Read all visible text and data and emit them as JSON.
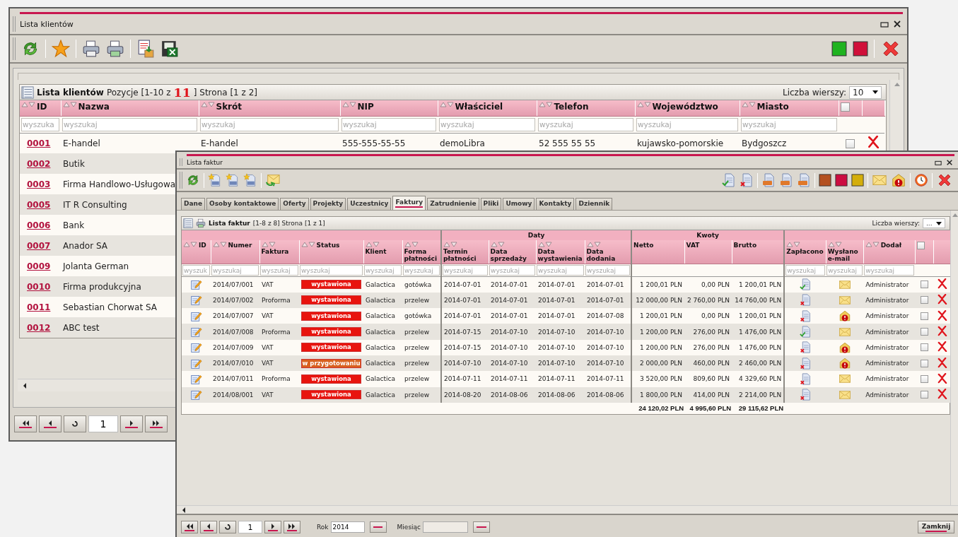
{
  "clients_window": {
    "title": "Lista klientów",
    "list_title": "Lista klientów",
    "positions_label": "Pozycje [1-10 z",
    "positions_count": "11",
    "page_label": "] Strona [1 z 2]",
    "rows_label": "Liczba wierszy:",
    "rows_value": "10",
    "columns": [
      {
        "kind": "text",
        "label": "ID",
        "placeholder": "wyszuka"
      },
      {
        "kind": "text",
        "label": "Nazwa",
        "placeholder": "wyszukaj"
      },
      {
        "kind": "text",
        "label": "Skrót",
        "placeholder": "wyszukaj"
      },
      {
        "kind": "text",
        "label": "NIP",
        "placeholder": "wyszukaj"
      },
      {
        "kind": "text",
        "label": "Właściciel",
        "placeholder": "wyszukaj"
      },
      {
        "kind": "text",
        "label": "Telefon",
        "placeholder": "wyszukaj"
      },
      {
        "kind": "text",
        "label": "Województwo",
        "placeholder": "wyszukaj"
      },
      {
        "kind": "text",
        "label": "Miasto",
        "placeholder": "wyszukaj"
      },
      {
        "kind": "checkbox",
        "checked": false
      },
      {
        "kind": "blank"
      }
    ],
    "rows": [
      {
        "id": "0001",
        "name": "E-handel",
        "short": "E-handel",
        "nip": "555-555-55-55",
        "owner": "demoLibra",
        "phone": "52 555 55 55",
        "region": "kujawsko-pomorskie",
        "city": "Bydgoszcz",
        "checked": false
      },
      {
        "id": "0002",
        "name": "Butik"
      },
      {
        "id": "0003",
        "name": "Firma Handlowo-Usługowa"
      },
      {
        "id": "0005",
        "name": "IT R Consulting"
      },
      {
        "id": "0006",
        "name": "Bank"
      },
      {
        "id": "0007",
        "name": "Anador SA"
      },
      {
        "id": "0009",
        "name": "Jolanta German"
      },
      {
        "id": "0010",
        "name": "Firma produkcyjna"
      },
      {
        "id": "0011",
        "name": "Sebastian Chorwat SA"
      },
      {
        "id": "0012",
        "name": "ABC test"
      }
    ],
    "page": "1"
  },
  "invoices_window": {
    "title": "Lista faktur",
    "tabs": [
      {
        "label": "Dane",
        "selected": false
      },
      {
        "label": "Osoby kontaktowe",
        "selected": false
      },
      {
        "label": "Oferty",
        "selected": false
      },
      {
        "label": "Projekty",
        "selected": false
      },
      {
        "label": "Uczestnicy",
        "selected": false
      },
      {
        "label": "Faktury",
        "selected": true
      },
      {
        "label": "Zatrudnienie",
        "selected": false
      },
      {
        "label": "Pliki",
        "selected": false
      },
      {
        "label": "Umowy",
        "selected": false
      },
      {
        "label": "Kontakty",
        "selected": false
      },
      {
        "label": "Dziennik",
        "selected": false
      }
    ],
    "list_title": "Lista faktur",
    "list_info": "[1-8 z 8] Strona [1 z 1]",
    "rows_label": "Liczba wierszy:",
    "rows_value": "...",
    "column_groups": [
      {
        "columns": [
          {
            "kind": "text",
            "label": "ID",
            "sortable": true,
            "placeholder": "wyszuk"
          },
          {
            "kind": "text",
            "label": "Numer",
            "sortable": true,
            "placeholder": "wyszukaj"
          },
          {
            "kind": "text",
            "label": "Faktura",
            "sortable": true,
            "placeholder": "wyszukaj"
          },
          {
            "kind": "text",
            "label": "Status",
            "sortable": true,
            "placeholder": "wyszukaj"
          },
          {
            "kind": "text",
            "label": "Klient",
            "sortable": true,
            "placeholder": "wyszukaj"
          },
          {
            "kind": "text",
            "label": "Forma płatności",
            "sortable": true,
            "placeholder": "wyszukaj"
          }
        ]
      },
      {
        "label": "Daty",
        "columns": [
          {
            "kind": "text",
            "label": "Termin płatności",
            "sortable": true,
            "placeholder": "wyszukaj"
          },
          {
            "kind": "text",
            "label": "Data sprzedaży",
            "sortable": true,
            "placeholder": "wyszukaj"
          },
          {
            "kind": "text",
            "label": "Data wystawienia",
            "sortable": true,
            "placeholder": "wyszukaj"
          },
          {
            "kind": "text",
            "label": "Data dodania",
            "sortable": true,
            "placeholder": "wyszukaj"
          }
        ]
      },
      {
        "label": "Kwoty",
        "columns": [
          {
            "kind": "text",
            "label": "Netto",
            "sortable": false
          },
          {
            "kind": "text",
            "label": "VAT",
            "sortable": false
          },
          {
            "kind": "text",
            "label": "Brutto",
            "sortable": false
          }
        ]
      },
      {
        "columns": [
          {
            "kind": "text",
            "label": "Zapłacono",
            "sortable": true,
            "placeholder": "wyszukaj"
          },
          {
            "kind": "text",
            "label": "Wysłano e-mail",
            "sortable": true,
            "placeholder": "wyszukaj"
          },
          {
            "kind": "text",
            "label": "Dodał",
            "sortable": true,
            "placeholder": "wyszukaj"
          },
          {
            "kind": "checkbox",
            "checked": false
          },
          {
            "kind": "blank"
          }
        ]
      }
    ],
    "rows": [
      {
        "number": "2014/07/001",
        "type": "VAT",
        "status": "wystawiona",
        "color": "#e8140e",
        "client": "Galactica",
        "payment": "gotówka",
        "due": "2014-07-01",
        "sale": "2014-07-01",
        "issued": "2014-07-01",
        "added": "2014-07-01",
        "net": "1 200,01 PLN",
        "vat": "0,00 PLN",
        "gross": "1 200,01 PLN",
        "paid": true,
        "email_sent": true,
        "added_by": "Administrator",
        "checked": false
      },
      {
        "number": "2014/07/002",
        "type": "Proforma",
        "status": "wystawiona",
        "color": "#e8140e",
        "client": "Galactica",
        "payment": "przelew",
        "due": "2014-07-01",
        "sale": "2014-07-01",
        "issued": "2014-07-01",
        "added": "2014-07-01",
        "net": "12 000,00 PLN",
        "vat": "2 760,00 PLN",
        "gross": "14 760,00 PLN",
        "paid": false,
        "email_sent": true,
        "added_by": "Administrator",
        "checked": false
      },
      {
        "number": "2014/07/007",
        "type": "VAT",
        "status": "wystawiona",
        "color": "#e8140e",
        "client": "Galactica",
        "payment": "gotówka",
        "due": "2014-07-01",
        "sale": "2014-07-01",
        "issued": "2014-07-01",
        "added": "2014-07-08",
        "net": "1 200,01 PLN",
        "vat": "0,00 PLN",
        "gross": "1 200,01 PLN",
        "paid": false,
        "email_sent": false,
        "added_by": "Administrator",
        "checked": false
      },
      {
        "number": "2014/07/008",
        "type": "Proforma",
        "status": "wystawiona",
        "color": "#e8140e",
        "client": "Galactica",
        "payment": "przelew",
        "due": "2014-07-15",
        "sale": "2014-07-10",
        "issued": "2014-07-10",
        "added": "2014-07-10",
        "net": "1 200,00 PLN",
        "vat": "276,00 PLN",
        "gross": "1 476,00 PLN",
        "paid": true,
        "email_sent": true,
        "added_by": "Administrator",
        "checked": false
      },
      {
        "number": "2014/07/009",
        "type": "VAT",
        "status": "wystawiona",
        "color": "#e8140e",
        "client": "Galactica",
        "payment": "przelew",
        "due": "2014-07-15",
        "sale": "2014-07-10",
        "issued": "2014-07-10",
        "added": "2014-07-10",
        "net": "1 200,00 PLN",
        "vat": "276,00 PLN",
        "gross": "1 476,00 PLN",
        "paid": false,
        "email_sent": false,
        "added_by": "Administrator",
        "checked": false
      },
      {
        "number": "2014/07/010",
        "type": "VAT",
        "status": "w przygotowaniu",
        "color": "#d8601e",
        "client": "Galactica",
        "payment": "przelew",
        "due": "2014-07-10",
        "sale": "2014-07-10",
        "issued": "2014-07-10",
        "added": "2014-07-10",
        "net": "2 000,00 PLN",
        "vat": "460,00 PLN",
        "gross": "2 460,00 PLN",
        "paid": false,
        "email_sent": false,
        "added_by": "Administrator",
        "checked": false
      },
      {
        "number": "2014/07/011",
        "type": "Proforma",
        "status": "wystawiona",
        "color": "#e8140e",
        "client": "Galactica",
        "payment": "przelew",
        "due": "2014-07-11",
        "sale": "2014-07-11",
        "issued": "2014-07-11",
        "added": "2014-07-11",
        "net": "3 520,00 PLN",
        "vat": "809,60 PLN",
        "gross": "4 329,60 PLN",
        "paid": false,
        "email_sent": true,
        "added_by": "Administrator",
        "checked": false
      },
      {
        "number": "2014/08/001",
        "type": "VAT",
        "status": "wystawiona",
        "color": "#e8140e",
        "client": "Galactica",
        "payment": "przelew",
        "due": "2014-08-20",
        "sale": "2014-08-06",
        "issued": "2014-08-06",
        "added": "2014-08-06",
        "net": "1 800,00 PLN",
        "vat": "414,00 PLN",
        "gross": "2 214,00 PLN",
        "paid": false,
        "email_sent": true,
        "added_by": "Administrator",
        "checked": false
      }
    ],
    "totals": [
      "24 120,02 PLN",
      "4 995,60 PLN",
      "29 115,62 PLN"
    ],
    "page": "1",
    "year_label": "Rok",
    "year_value": "2014",
    "month_label": "Miesiąc",
    "close_label": "Zamknij"
  }
}
